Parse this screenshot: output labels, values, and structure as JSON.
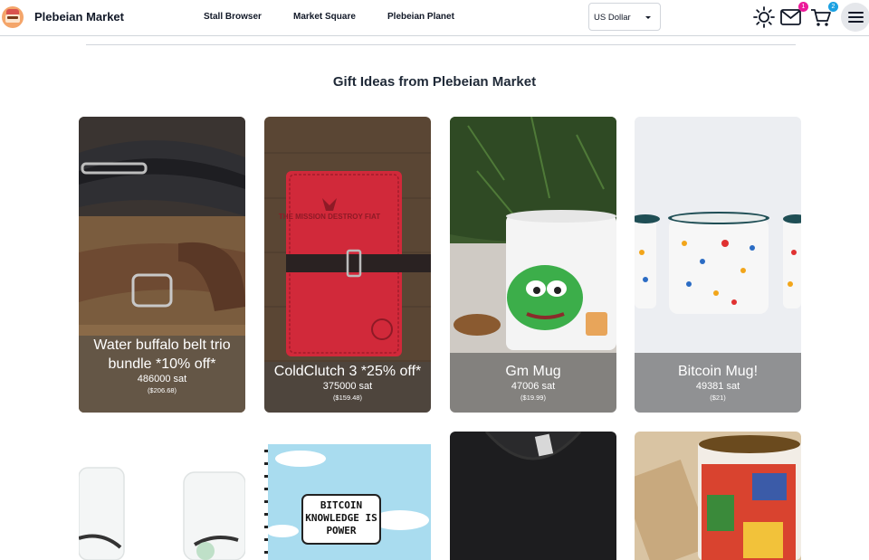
{
  "header": {
    "brand": "Plebeian Market",
    "nav": [
      {
        "label": "Stall Browser"
      },
      {
        "label": "Market Square"
      },
      {
        "label": "Plebeian Planet"
      }
    ],
    "currency": "US Dollar",
    "messages_badge": "1",
    "cart_badge": "2",
    "icons": [
      "logo",
      "sun-icon",
      "mail-icon",
      "cart-icon",
      "menu-icon"
    ],
    "colors": {
      "messages_badge": "#ec1a9a",
      "cart_badge": "#1ba1e2"
    }
  },
  "main": {
    "title": "Gift Ideas from Plebeian Market",
    "products": [
      {
        "name": "Water buffalo belt trio bundle *10% off*",
        "sat": "486000 sat",
        "usd": "($206.68)"
      },
      {
        "name": "ColdClutch 3 *25% off*",
        "sat": "375000 sat",
        "usd": "($159.48)"
      },
      {
        "name": "Gm Mug",
        "sat": "47006 sat",
        "usd": "($19.99)"
      },
      {
        "name": "Bitcoin Mug!",
        "sat": "49381 sat",
        "usd": "($21)"
      }
    ],
    "next_row": [
      {
        "image_text": "BITCOIN KNOWLEDGE IS POWER"
      }
    ],
    "wallet_text": "THE MISSION DESTROY FIAT"
  }
}
